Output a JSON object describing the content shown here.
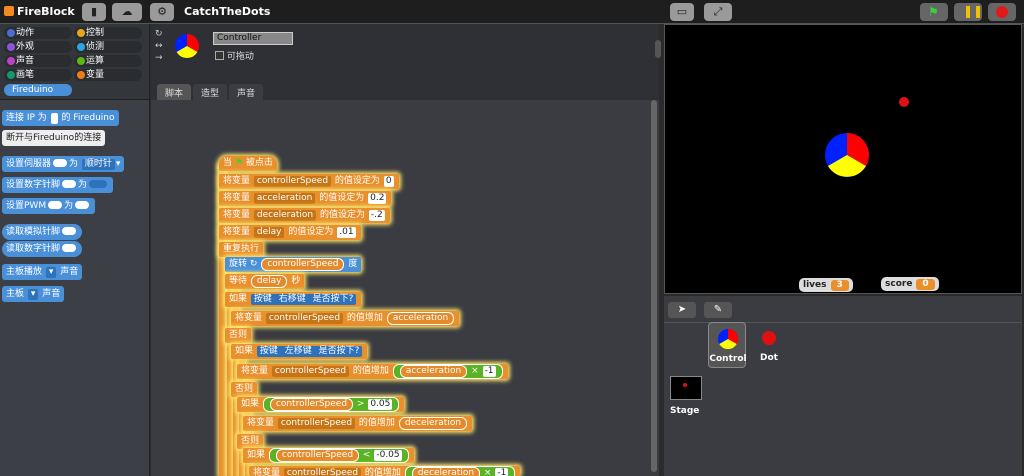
{
  "app": {
    "logo": "FireBlock",
    "project_title": "CatchTheDots"
  },
  "categories": [
    {
      "label": "动作",
      "color": "#4a6cd4"
    },
    {
      "label": "控制",
      "color": "#e1a91a"
    },
    {
      "label": "外观",
      "color": "#8a55d7"
    },
    {
      "label": "侦测",
      "color": "#2ca5e2"
    },
    {
      "label": "声音",
      "color": "#bb42c3"
    },
    {
      "label": "运算",
      "color": "#5cb712"
    },
    {
      "label": "画笔",
      "color": "#0e9a6c"
    },
    {
      "label": "变量",
      "color": "#ee7d16"
    },
    {
      "label": "Fireduino",
      "color": "#4a90d9"
    }
  ],
  "palette_blocks": {
    "connect": "连接 IP 为",
    "connect_suffix": "的 Fireduino",
    "disconnect": "断开与Fireduino的连接",
    "servo": "设置伺服器",
    "servo_to": "为",
    "servo_value": "顺时针",
    "digital": "设置数字针脚",
    "digital_to": "为",
    "pwm": "设置PWM",
    "pwm_to": "为",
    "read_analog": "读取模拟针脚",
    "read_digital": "读取数字针脚",
    "buzzer": "主板播放",
    "buzzer_suffix": "声音",
    "board": "主板",
    "board_suffix": "声音"
  },
  "sprite": {
    "name": "Controller",
    "draggable_label": "可拖动"
  },
  "tabs": [
    "脚本",
    "造型",
    "声音"
  ],
  "script": {
    "hat": "当",
    "hat_suffix": "被点击",
    "set": "将变量",
    "set_to": "的值设定为",
    "v1": "controllerSpeed",
    "v1val": "0",
    "v2": "acceleration",
    "v2val": "0.2",
    "v3": "deceleration",
    "v3val": "-.2",
    "v4": "delay",
    "v4val": ".01",
    "forever": "重复执行",
    "turn": "旋转",
    "turn_suffix": "度",
    "turn_var": "controllerSpeed",
    "wait": "等待",
    "wait_var": "delay",
    "wait_suffix": "秒",
    "if": "如果",
    "key": "按键",
    "key_right": "右移键",
    "key_left": "左移键",
    "pressed": "是否按下?",
    "change": "将变量",
    "change_by": "的值增加",
    "acc": "acceleration",
    "dec": "deceleration",
    "else": "否则",
    "times": "×",
    "neg1": "-1",
    "gt": ">",
    "lt": "<",
    "gtval": "0.05",
    "ltval": "-0.05"
  },
  "stage": {
    "lives_label": "lives",
    "lives_value": "3",
    "score_label": "score",
    "score_value": "0"
  },
  "sprites": [
    {
      "name": "Control"
    },
    {
      "name": "Dot"
    }
  ],
  "stage_label": "Stage",
  "colors": {
    "accent": "#4a90d9",
    "control": "#e1a91a",
    "variable": "#e9902d",
    "operator": "#59b324"
  }
}
